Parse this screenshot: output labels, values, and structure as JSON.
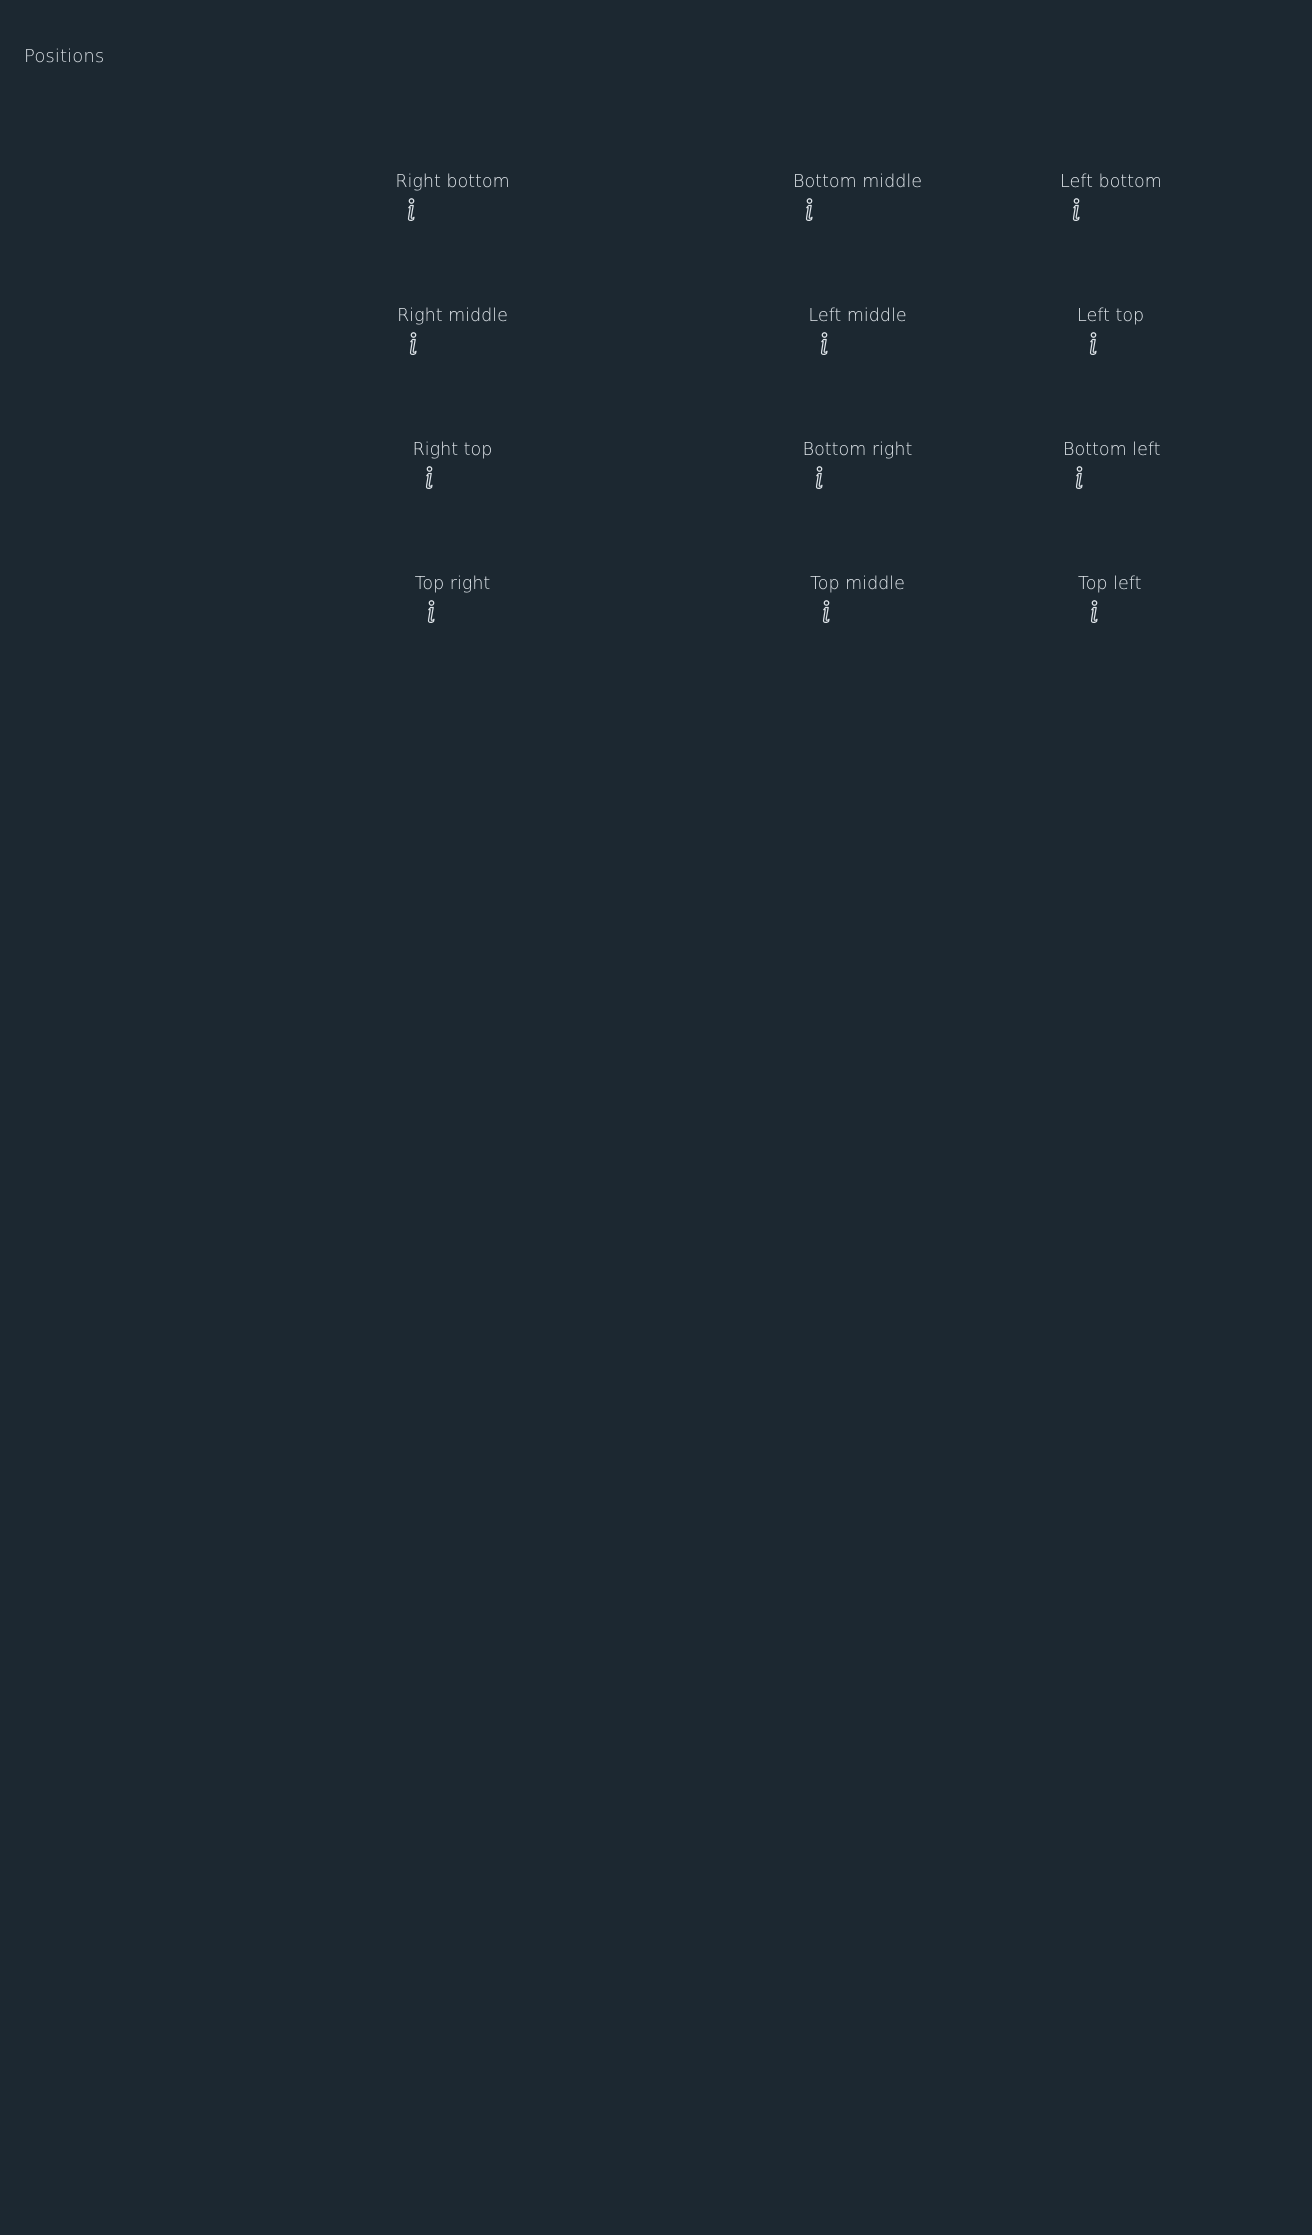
{
  "page": {
    "title": "Positions"
  },
  "positions": [
    {
      "label": "Right bottom",
      "icon": "info-icon"
    },
    {
      "label": "Bottom middle",
      "icon": "info-icon"
    },
    {
      "label": "Left bottom",
      "icon": "info-icon"
    },
    {
      "label": "Right middle",
      "icon": "info-icon"
    },
    {
      "label": "Left middle",
      "icon": "info-icon"
    },
    {
      "label": "Left top",
      "icon": "info-icon"
    },
    {
      "label": "Right top",
      "icon": "info-icon"
    },
    {
      "label": "Bottom right",
      "icon": "info-icon"
    },
    {
      "label": "Bottom left",
      "icon": "info-icon"
    },
    {
      "label": "Top right",
      "icon": "info-icon"
    },
    {
      "label": "Top middle",
      "icon": "info-icon"
    },
    {
      "label": "Top left",
      "icon": "info-icon"
    }
  ],
  "colors": {
    "background": "#1c2831",
    "text": "#dfe5ea"
  }
}
